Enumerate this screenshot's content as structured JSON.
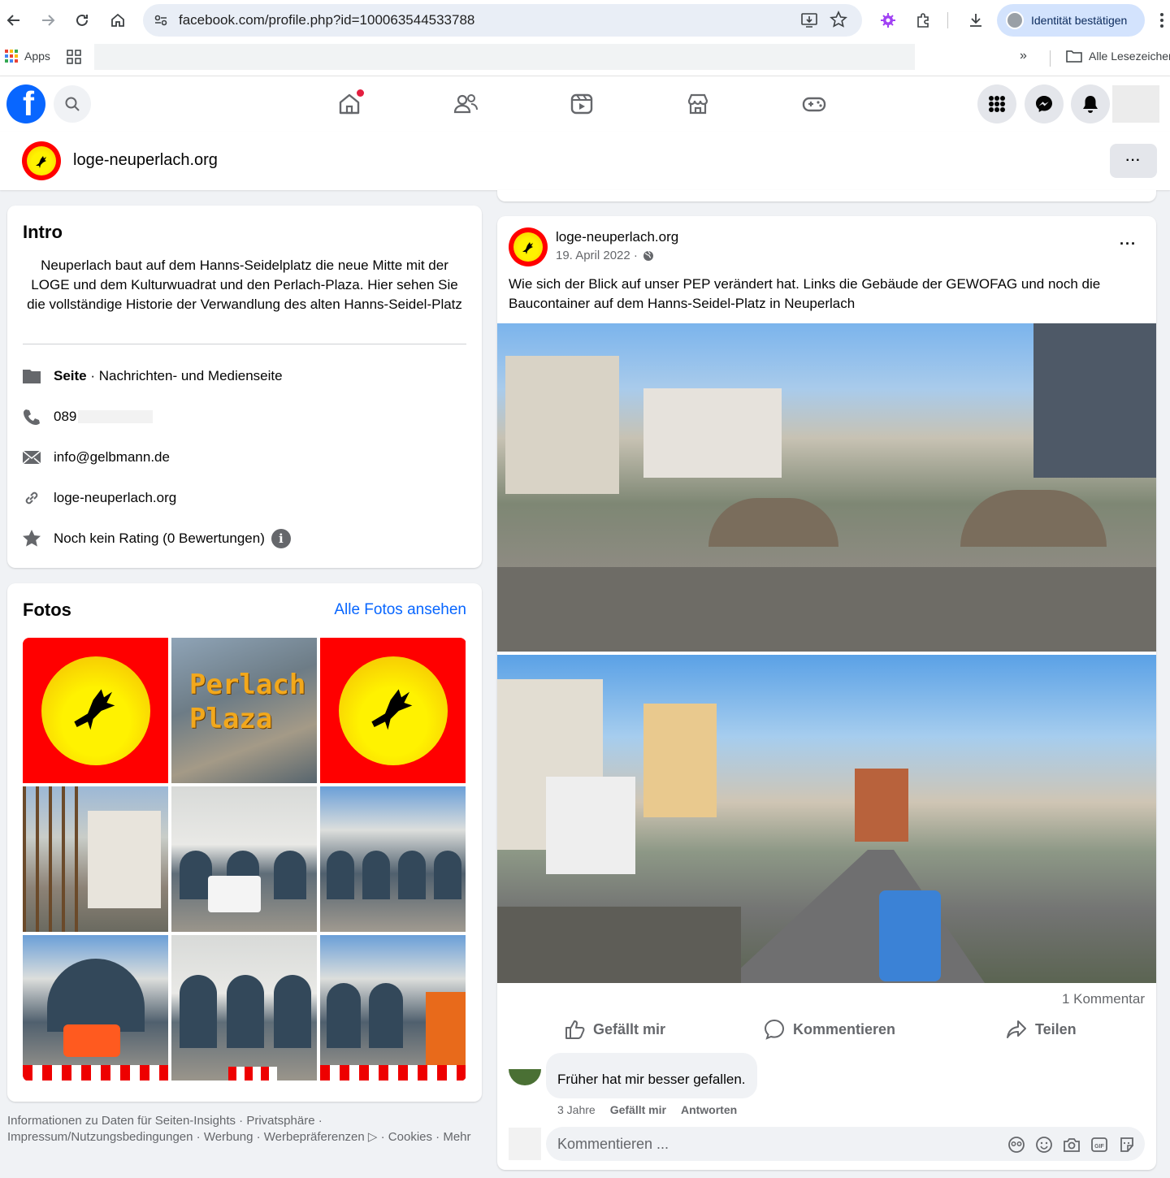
{
  "browser": {
    "url": "facebook.com/profile.php?id=100063544533788",
    "identity_button": "Identität bestätigen",
    "bookmarks": {
      "apps_label": "Apps",
      "all_bookmarks": "Alle Lesezeichen"
    }
  },
  "colors": {
    "fb_blue": "#0866ff",
    "logo_red": "#ff0000",
    "logo_yellow": "#fff200",
    "notification_red": "#e41e3f"
  },
  "page": {
    "name": "loge-neuperlach.org"
  },
  "intro": {
    "heading": "Intro",
    "bio": "Neuperlach baut auf dem Hanns-Seidelplatz die neue Mitte mit der LOGE und dem Kulturwuadrat und den Perlach-Plaza. Hier sehen Sie die vollständige Historie der Verwandlung des alten Hanns-Seidel-Platz",
    "category_label": "Seite",
    "category_value": " · Nachrichten- und Medienseite",
    "phone": "089",
    "email": "info@gelbmann.de",
    "website": "loge-neuperlach.org",
    "rating": "Noch kein Rating (0 Bewertungen)"
  },
  "fotos": {
    "heading": "Fotos",
    "see_all": "Alle Fotos ansehen",
    "aerial_caption_1": "Perlach",
    "aerial_caption_2": "Plaza"
  },
  "post": {
    "author": "loge-neuperlach.org",
    "date": "19. April 2022 ·",
    "text": "Wie sich der Blick auf unser PEP verändert hat. Links die Gebäude der GEWOFAG und noch die Baucontainer auf dem Hanns-Seidel-Platz in Neuperlach",
    "comment_count": "1 Kommentar",
    "actions": {
      "like": "Gefällt mir",
      "comment": "Kommentieren",
      "share": "Teilen"
    },
    "comment": {
      "text": "Früher hat mir besser gefallen.",
      "age": "3 Jahre",
      "like": "Gefällt mir",
      "reply": "Antworten"
    },
    "reply_placeholder": "Kommentieren ..."
  },
  "footer": {
    "links": [
      "Informationen zu Daten für Seiten-Insights",
      "Privatsphäre",
      "Impressum/Nutzungsbedingungen",
      "Werbung",
      "Werbepräferenzen",
      "Cookies",
      "Mehr"
    ]
  },
  "icons": [
    "back-icon",
    "forward-icon",
    "reload-icon",
    "home-icon",
    "site-info-icon",
    "install-icon",
    "star-icon",
    "extension-icon",
    "puzzle-icon",
    "download-icon",
    "kebab-icon",
    "home-tab-icon",
    "friends-icon",
    "video-icon",
    "marketplace-icon",
    "gaming-icon",
    "menu-grid-icon",
    "messenger-icon",
    "bell-icon",
    "search-icon",
    "globe-icon",
    "like-icon",
    "comment-icon",
    "share-icon"
  ]
}
